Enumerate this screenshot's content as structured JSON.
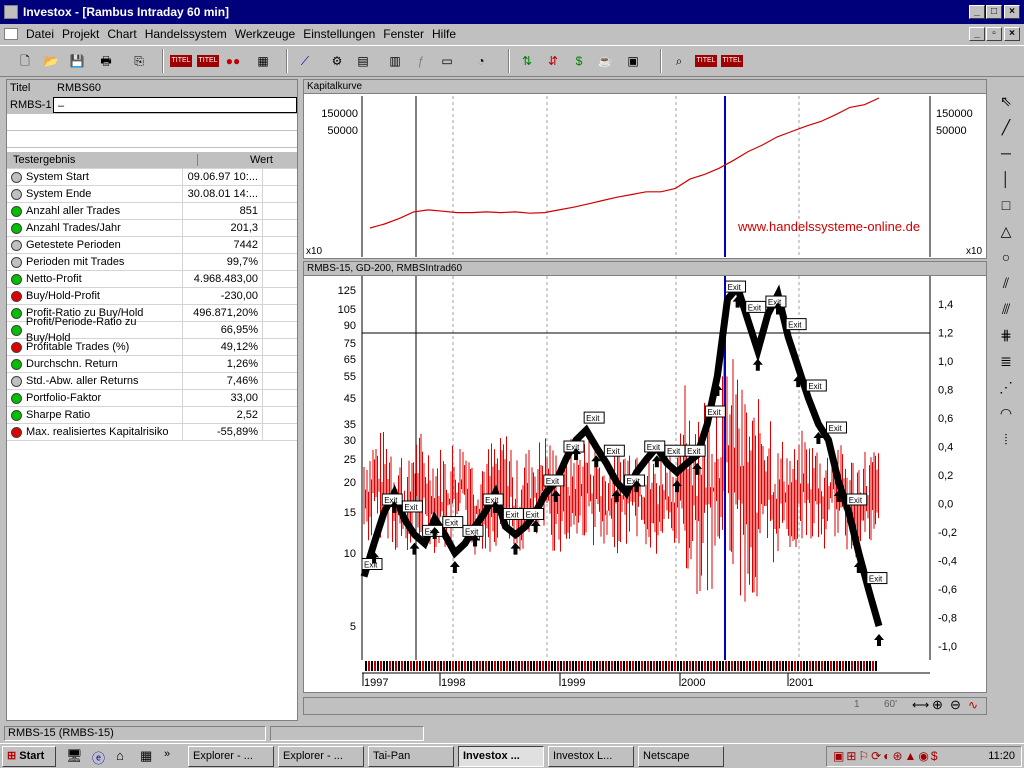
{
  "window": {
    "title": "Investox - [Rambus Intraday 60 min]"
  },
  "menu": [
    "Datei",
    "Projekt",
    "Chart",
    "Handelssystem",
    "Werkzeuge",
    "Einstellungen",
    "Fenster",
    "Hilfe"
  ],
  "toolbar": {
    "titel": "TITEL"
  },
  "titlegrid": {
    "h1": "Titel",
    "h2": "RMBS60",
    "r1": "RMBS-1",
    "r2": "–"
  },
  "results": {
    "h1": "Testergebnis",
    "h2": "Wert",
    "rows": [
      {
        "label": "System Start",
        "value": "09.06.97 10:...",
        "color": "#c0c0c0"
      },
      {
        "label": "System Ende",
        "value": "30.08.01 14:...",
        "color": "#c0c0c0"
      },
      {
        "label": "Anzahl aller Trades",
        "value": "851",
        "color": "#00c000"
      },
      {
        "label": "Anzahl Trades/Jahr",
        "value": "201,3",
        "color": "#00c000"
      },
      {
        "label": "Getestete Perioden",
        "value": "7442",
        "color": "#c0c0c0"
      },
      {
        "label": "Perioden mit Trades",
        "value": "99,7%",
        "color": "#c0c0c0"
      },
      {
        "label": "Netto-Profit",
        "value": "4.968.483,00",
        "color": "#00c000"
      },
      {
        "label": "Buy/Hold-Profit",
        "value": "-230,00",
        "color": "#e00000"
      },
      {
        "label": "Profit-Ratio zu Buy/Hold",
        "value": "496.871,20%",
        "color": "#00c000"
      },
      {
        "label": "Profit/Periode-Ratio zu Buy/Hold",
        "value": "66,95%",
        "color": "#00c000"
      },
      {
        "label": "Profitable Trades (%)",
        "value": "49,12%",
        "color": "#e00000"
      },
      {
        "label": "Durchschn. Return",
        "value": "1,26%",
        "color": "#00c000"
      },
      {
        "label": "Std.-Abw. aller Returns",
        "value": "7,46%",
        "color": "#c0c0c0"
      },
      {
        "label": "Portfolio-Faktor",
        "value": "33,00",
        "color": "#00c000"
      },
      {
        "label": "Sharpe Ratio",
        "value": "2,52",
        "color": "#00c000"
      },
      {
        "label": "Max. realisiertes Kapitalrisiko",
        "value": "-55,89%",
        "color": "#e00000"
      }
    ]
  },
  "chart_data": [
    {
      "type": "line",
      "title": "Kapitalkurve",
      "ytick_labels": [
        "150000",
        "50000"
      ],
      "ylabel_mult": "x10",
      "watermark": "www.handelssysteme-online.de",
      "series": [
        {
          "values": [
            0.06,
            0.12,
            0.2,
            0.3,
            0.33,
            0.31,
            0.29,
            0.29,
            0.3,
            0.29,
            0.3,
            0.28,
            0.29,
            0.33,
            0.37,
            0.42,
            0.47,
            0.52,
            0.56,
            0.6,
            0.6,
            0.65,
            0.79,
            0.86,
            0.95,
            1.07,
            1.2,
            1.3,
            1.42,
            1.5,
            1.58,
            1.65,
            1.75,
            1.86,
            1.9,
            2.0
          ]
        }
      ],
      "color": "#d00000"
    },
    {
      "type": "line",
      "title": "RMBS-15, GD-200, RMBSIntrad60",
      "left_ticks": [
        "125",
        "105",
        "90",
        "75",
        "65",
        "55",
        "45",
        "35",
        "30",
        "25",
        "20",
        "15",
        "10",
        "5"
      ],
      "right_ticks": [
        "1,4",
        "1,2",
        "1,0",
        "0,8",
        "0,6",
        "0,4",
        "0,2",
        "0,0",
        "-0,2",
        "-0,4",
        "-0,6",
        "-0,8",
        "-1,0"
      ],
      "x_ticks": [
        "1997",
        "1998",
        "1999",
        "2000",
        "2001"
      ],
      "exit_label": "Exit",
      "series": [
        {
          "name": "price",
          "color": "#000000",
          "values": [
            8,
            11,
            15,
            18,
            14,
            12,
            11,
            14,
            12,
            10,
            11,
            13,
            15,
            18,
            13,
            12,
            13,
            15,
            18,
            20,
            25,
            30,
            33,
            28,
            24,
            20,
            18,
            22,
            25,
            28,
            24,
            22,
            24,
            26,
            35,
            55,
            115,
            130,
            95,
            70,
            100,
            120,
            80,
            60,
            45,
            35,
            30,
            20,
            15,
            10,
            7,
            5
          ]
        },
        {
          "name": "oscillator",
          "color": "#e00000",
          "values": [
            0.05,
            0.1,
            0.1,
            0.0,
            -0.1,
            0.1,
            0.05,
            0.0,
            0.0,
            0.05,
            0.1,
            -0.05,
            0.0,
            0.05,
            0.1,
            -0.1,
            0.0,
            0.05,
            0.1,
            0.0,
            0.0,
            0.05,
            0.1,
            0.05,
            -0.05,
            0.0,
            0.05,
            0.1,
            0.0,
            -0.05,
            0.05,
            0.0,
            0.1,
            0.05,
            0.0,
            0.1,
            0.3,
            0.2,
            0.0,
            -0.1,
            0.1,
            0.0,
            0.05,
            0.0,
            0.1,
            0.05,
            0.0,
            0.1,
            0.0,
            -0.05,
            0.0,
            0.0
          ]
        }
      ]
    }
  ],
  "statusbar": {
    "left": "RMBS-15 (RMBS-15)",
    "scale": "60'",
    "page": "1"
  },
  "taskbar": {
    "start": "Start",
    "items": [
      "Explorer - ...",
      "Explorer - ...",
      "Tai-Pan",
      "Investox ...",
      "Investox L...",
      "Netscape"
    ],
    "clock": "11:20"
  }
}
